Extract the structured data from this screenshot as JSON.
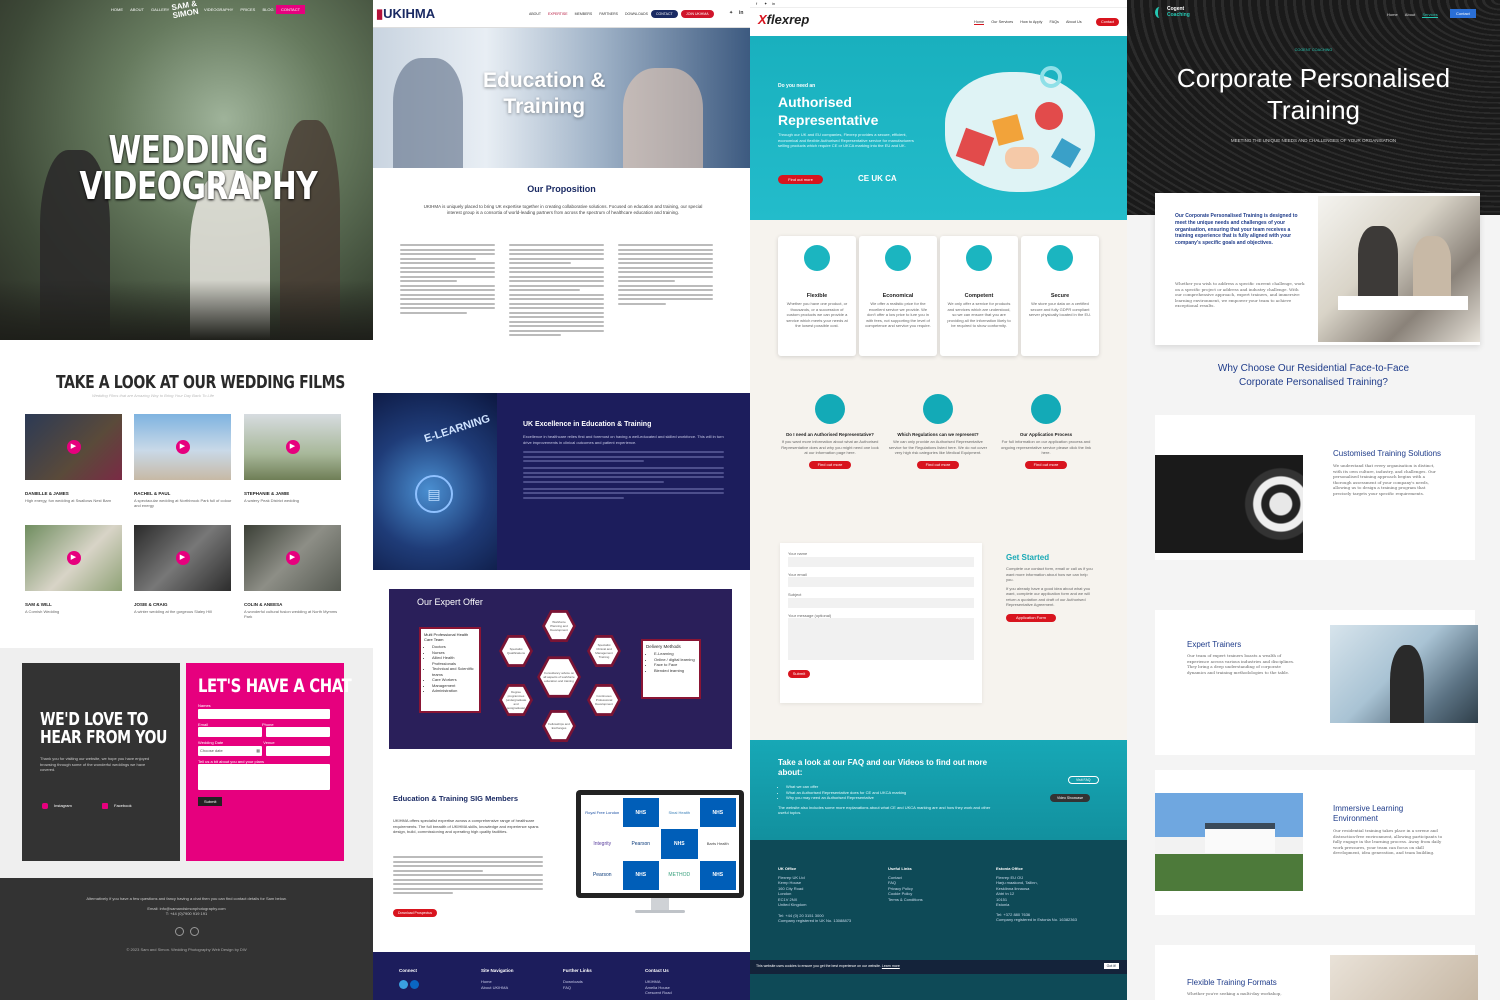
{
  "panel1": {
    "nav": [
      "HOME",
      "ABOUT",
      "GALLERY",
      "VIDEOGRAPHY",
      "PRICES",
      "BLOG"
    ],
    "nav_cta": "CONTACT",
    "logo": "SAM & SIMON",
    "hero_title_1": "WEDDING",
    "hero_title_2": "VIDEOGRAPHY",
    "films_title": "TAKE A LOOK AT OUR WEDDING FILMS",
    "films_subtitle": "Wedding Films that are Amazing Way to Bring Your Day Back To Life",
    "films": [
      {
        "title": "DANIELLE & JAMES",
        "desc": "High energy, fun wedding at Swallows Nest Barn"
      },
      {
        "title": "RACHEL & PAUL",
        "desc": "A spectacular wedding at Northbrook Park full of colour and energy"
      },
      {
        "title": "STEPHANIE & JAMIE",
        "desc": "A watery Peak District wedding"
      },
      {
        "title": "SAM & WILL",
        "desc": "A Cornish Wedding"
      },
      {
        "title": "JOSIE & CRAIG",
        "desc": "A winter wedding at the gorgeous Slaley Hill"
      },
      {
        "title": "COLIN & ANEESA",
        "desc": "A wonderful cultural fusion wedding at North Mymms Park"
      }
    ],
    "contact_left_title": "WE'D LOVE TO HEAR FROM YOU",
    "contact_left_text": "Thank you for visiting our website, we hope you have enjoyed browsing through some of the wonderful weddings we have covered.",
    "instagram": "Instagram",
    "facebook": "Facebook",
    "chat_title": "LET'S HAVE A CHAT",
    "labels": {
      "name": "Names",
      "email": "Email",
      "phone": "Phone",
      "date": "Wedding Date",
      "venue": "Venue",
      "tell": "Tell us a bit about you and your plans"
    },
    "date_placeholder": "Choose date",
    "submit": "Submit",
    "footer_text": "Alternatively if you have a few questions and fancy having a chat then you can find contact details for Sam below.",
    "footer_email": "Email: info@samandsimonphotography.com",
    "footer_phone": "T: +44 (0)7900 919 191",
    "copyright": "© 2023 Sam and Simon. Wedding Photography Web Design by DW"
  },
  "panel2": {
    "logo": "UKIHMA",
    "nav": [
      "ABOUT",
      "EXPERTISE",
      "MEMBERS",
      "PARTNERS",
      "DOWNLOADS"
    ],
    "contact_btn": "CONTACT",
    "join_btn": "JOIN UKIHMA",
    "hero_title_1": "Education &",
    "hero_title_2": "Training",
    "proposition_title": "Our Proposition",
    "proposition_text": "UKIHMA is uniquely placed to bring UK expertise together in creating collaborative solutions. Focused on education and training, our special interest group is a consortia of world-leading partners from across the spectrum of healthcare education and training.",
    "elearning": "E-LEARNING",
    "excellence_title": "UK Excellence in Education & Training",
    "excellence_text": "Excellence in healthcare relies first and foremost on having a well-educated and skilled workforce. This will in turn drive improvements in clinical outcomes and patient experience.",
    "offer_title": "Our Expert Offer",
    "offer_left_title": "Multi Professional Health Care Team",
    "offer_left_items": [
      "Doctors",
      "Nurses",
      "Allied Health Professionals",
      "Technical and Scientific teams",
      "Care Workers",
      "Management",
      "Administration"
    ],
    "offer_right_title": "Delivery Methods",
    "offer_right_items": [
      "E-Learning",
      "Online / digital learning",
      "Face to Face",
      "Blended learning"
    ],
    "hexes": [
      "Workforce Planning and Development",
      "Specialist Qualifications",
      "Specialist Clinical and Management Training",
      "Consultancy advice on all aspects of workforce education and training",
      "Degree programmes (undergraduate and postgraduate)",
      "Continuous Professional Development",
      "Fellowships and Exchanges"
    ],
    "sig_title": "Education & Training SIG Members",
    "sig_text": "UKIHMA offers specialist expertise across a comprehensive range of healthcare requirements. The full breadth of UKIHMA skills, knowledge and experience spans design, build, commissioning and operating high quality facilities.",
    "download_btn": "Download Prospectus",
    "partners": [
      "Royal Free London",
      "NHS",
      "Sinai Health",
      "NHS",
      "Integrity",
      "Pearson",
      "NHS",
      "Barts Health",
      "Pearson",
      "NHS",
      "METHOD",
      "NHS"
    ],
    "footer_headings": [
      "Connect",
      "Site Navigation",
      "Further Links",
      "Contact Us"
    ],
    "footer_links": [
      "Home",
      "About UKIHMA",
      "Downloads",
      "FAQ",
      "UKIHMA",
      "Amelia House",
      "Crescent Road"
    ]
  },
  "panel3": {
    "logo": "flexrep",
    "nav": [
      "Home",
      "Our Services",
      "How to Apply",
      "FAQs",
      "About Us"
    ],
    "contact_btn": "Contact",
    "hero_eyebrow": "Do you need an",
    "hero_title_1": "Authorised",
    "hero_title_2": "Representative",
    "hero_text": "Through our UK and EU companies, Flexrep provides a secure, efficient, economical and flexible Authorised Representative service for manufacturers selling products which require CE or UKCA marking into the EU and UK.",
    "hero_btn": "Find out more",
    "marks": "CE UK CA",
    "cards": [
      {
        "title": "Flexible",
        "text": "Whether you have one product, or thousands, or a succession of custom products we can provide a service which meets your needs at the lowest possible cost."
      },
      {
        "title": "Economical",
        "text": "We offer a realistic price for the excellent service we provide. We don't offer a low price to lure you in with fees, not supporting the level of competence and service you require."
      },
      {
        "title": "Competent",
        "text": "We only offer a service for products and services which are understood, so we can ensure that you are providing all the information likely to be required to show conformity."
      },
      {
        "title": "Secure",
        "text": "We store your data on a certified secure and fully GDPR compliant server physically located in the EU."
      }
    ],
    "info": [
      {
        "title": "Do I need an Authorised Representative?",
        "text": "If you want more information about what an Authorised Representative does and why you might need one look at our information page here.",
        "btn": "Find out more"
      },
      {
        "title": "Which Regulations can we represent?",
        "text": "We can only provide an Authorised Representative service for the Regulations listed here. We do not cover very high risk categories like Medical Equipment.",
        "btn": "Find out more"
      },
      {
        "title": "Our Application Process",
        "text": "For full information on our application process and ongoing representative service please click the link here.",
        "btn": "Find out more"
      }
    ],
    "form_labels": [
      "Your name",
      "Your email",
      "Subject",
      "Your message (optional)"
    ],
    "submit": "Submit",
    "get_started_title": "Get Started",
    "get_started_text_1": "Complete our contact form, email or call us if you want more information about how we can help you.",
    "get_started_text_2": "If you already have a good idea about what you want, complete our application form and we will return a quotation and draft of our Authorised Representative Agreement.",
    "app_btn": "Application Form",
    "faq_title": "Take a look at our FAQ and our Videos to find out more about:",
    "faq_items": [
      "What we can offer",
      "What an Authorised Representative does for CE and UKCA marking",
      "Why you may need an Authorised Representative"
    ],
    "faq_note": "The website also includes some more explanations about what CE and UKCA marking are and how they work and other useful topics.",
    "visit_faq": "Visit FAQ",
    "video_btn": "Video Showcase",
    "footer_cols": [
      {
        "title": "UK Office",
        "lines": [
          "Flexrep UK Ltd",
          "Kemp House",
          "160 City Road",
          "London",
          "EC1V 2NX",
          "United Kingdom",
          "",
          "Tel: +44 (0) 20 3151 3000",
          "Company registered in UK No. 13088873"
        ]
      },
      {
        "title": "Useful Links",
        "lines": [
          "Contact",
          "FAQ",
          "Privacy Policy",
          "Cookie Policy",
          "Terms & Conditions"
        ]
      },
      {
        "title": "Estonia Office",
        "lines": [
          "Flexrep EU OÜ",
          "Harju maakond, Tallinn,",
          "Kesklinna linnaosa",
          "Ahtri tn 12",
          "10151",
          "Estonia",
          "Tel: +372 880 7636",
          "Company registered in Estonia No. 16382363"
        ]
      }
    ],
    "cookie_text": "This website uses cookies to ensure you get the best experience on our website.",
    "cookie_link": "Learn more",
    "cookie_btn": "Got it!"
  },
  "panel4": {
    "logo_1": "Cogent",
    "logo_2": "Coaching",
    "nav": [
      "Home",
      "About",
      "Services"
    ],
    "nav_cta": "Contact",
    "eyebrow": "COGENT COACHING",
    "hero_title_1": "Corporate Personalised",
    "hero_title_2": "Training",
    "hero_sub": "MEETING THE UNIQUE NEEDS AND CHALLENGES OF YOUR ORGANISATION",
    "intro_bold": "Our Corporate Personalised Training is designed to meet the unique needs and challenges of your organisation, ensuring that your team receives a training experience that is fully aligned with your company's specific goals and objectives.",
    "intro_text": "Whether you wish to address a specific current challenge, work on a specific project or address and industry challenge. With our comprehensive approach, expert trainers, and immersive learning environment, we empower your team to achieve exceptional results.",
    "why_title_1": "Why Choose Our Residential Face-to-Face",
    "why_title_2": "Corporate Personalised Training?",
    "features": [
      {
        "title": "Customised Training Solutions",
        "text": "We understand that every organisation is distinct, with its own culture, industry, and challenges. Our personalised training approach begins with a thorough assessment of your company's needs, allowing us to design a training program that precisely targets your specific requirements."
      },
      {
        "title": "Expert Trainers",
        "text": "Our team of expert trainers boasts a wealth of experience across various industries and disciplines. They bring a deep understanding of corporate dynamics and training methodologies to the table."
      },
      {
        "title": "Immersive Learning Environment",
        "text": "Our residential training takes place in a serene and distraction-free environment, allowing participants to fully engage in the learning process. Away from daily work pressures, your team can focus on skill development, idea generation, and team building."
      },
      {
        "title": "Flexible Training Formats",
        "text": "Whether you're seeking a multi-day workshop,"
      }
    ]
  }
}
